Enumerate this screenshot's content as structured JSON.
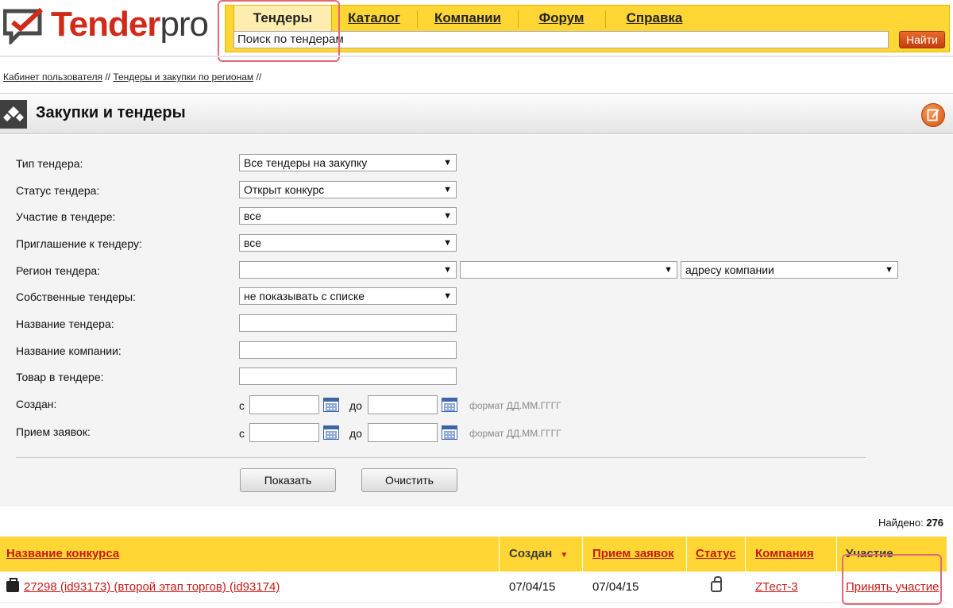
{
  "logo": {
    "main": "Tender",
    "suffix": "pro"
  },
  "nav": {
    "tabs": [
      {
        "label": "Тендеры"
      },
      {
        "label": "Каталог"
      },
      {
        "label": "Компании"
      },
      {
        "label": "Форум"
      },
      {
        "label": "Справка"
      }
    ],
    "search_value": "Поиск по тендерам",
    "search_button": "Найти"
  },
  "breadcrumb": {
    "items": [
      "Кабинет пользователя",
      "Тендеры и закупки по регионам"
    ],
    "separator": "//"
  },
  "page_title": "Закупки и тендеры",
  "form": {
    "tender_type": {
      "label": "Тип тендера:",
      "value": "Все тендеры на закупку"
    },
    "tender_status": {
      "label": "Статус тендера:",
      "value": "Открыт конкурс"
    },
    "participation": {
      "label": "Участие в тендере:",
      "value": "все"
    },
    "invitation": {
      "label": "Приглашение к тендеру:",
      "value": "все"
    },
    "region": {
      "label": "Регион тендера:",
      "value1": "",
      "value2": "",
      "value3": "адресу компании"
    },
    "own_tenders": {
      "label": "Собственные тендеры:",
      "value": "не показывать с списке"
    },
    "tender_name": {
      "label": "Название тендера:"
    },
    "company_name": {
      "label": "Название компании:"
    },
    "product": {
      "label": "Товар в тендере:"
    },
    "created": {
      "label": "Создан:"
    },
    "accepting": {
      "label": "Прием заявок:"
    },
    "from": "с",
    "to": "до",
    "date_hint": "формат ДД.ММ.ГГГГ",
    "show_button": "Показать",
    "clear_button": "Очистить"
  },
  "results": {
    "found_label": "Найдено:",
    "found_count": "276",
    "columns": {
      "name": "Название конкурса",
      "created": "Создан",
      "accepting": "Прием заявок",
      "status": "Статус",
      "company": "Компания",
      "participation": "Участие"
    },
    "sort_indicator": "▼",
    "rows": [
      {
        "name": "27298   (id93173) (второй этап торгов) (id93174)",
        "created": "07/04/15",
        "accepting": "07/04/15",
        "company": "ZТест-3",
        "action": "Принять участие"
      }
    ]
  }
}
